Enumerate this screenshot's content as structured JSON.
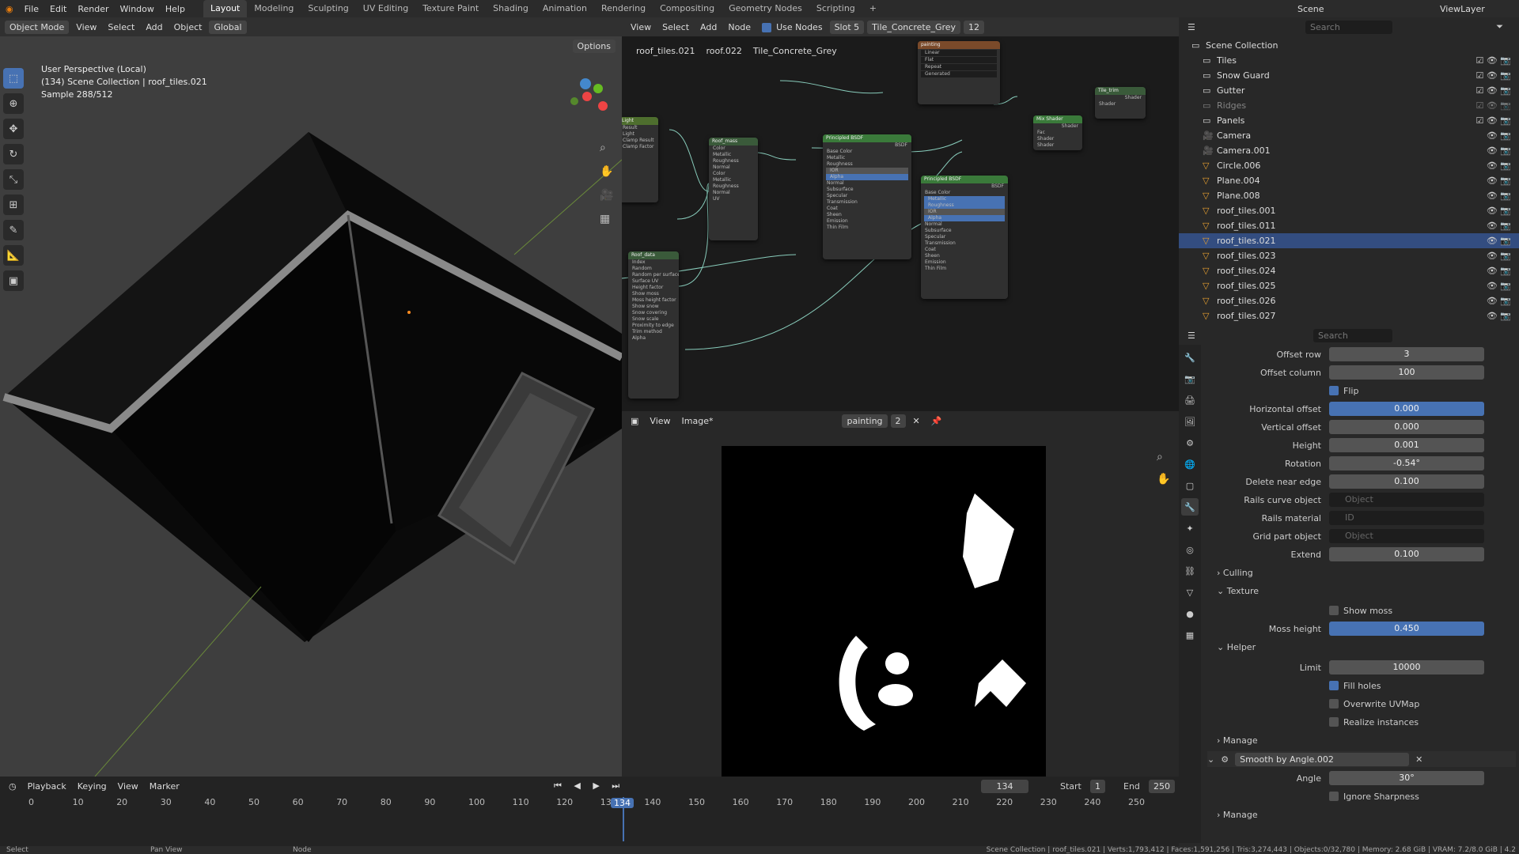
{
  "menu": [
    "File",
    "Edit",
    "Render",
    "Window",
    "Help"
  ],
  "workspaces": [
    "Layout",
    "Modeling",
    "Sculpting",
    "UV Editing",
    "Texture Paint",
    "Shading",
    "Animation",
    "Rendering",
    "Compositing",
    "Geometry Nodes",
    "Scripting"
  ],
  "top_right": {
    "scene": "Scene",
    "view_layer": "ViewLayer"
  },
  "viewport": {
    "mode": "Object Mode",
    "menus": [
      "View",
      "Select",
      "Add",
      "Object"
    ],
    "orientation": "Global",
    "options": "Options",
    "info_line1": "User Perspective (Local)",
    "info_line2": "(134) Scene Collection | roof_tiles.021",
    "info_line3": "Sample 288/512"
  },
  "node_editor": {
    "menus": [
      "View",
      "Select",
      "Add",
      "Node"
    ],
    "use_nodes": "Use Nodes",
    "slot": "Slot 5",
    "material": "Tile_Concrete_Grey",
    "users": "12",
    "breadcrumb": [
      "roof_tiles.021",
      "roof.022",
      "Tile_Concrete_Grey"
    ],
    "nodes": {
      "roof_mass": {
        "title": "Roof_mass",
        "rows": [
          "Color",
          "Metallic",
          "Roughness",
          "Normal",
          "Color",
          "Metallic",
          "Roughness",
          "Normal",
          "UV"
        ]
      },
      "roof_data": {
        "title": "Roof_data",
        "rows": [
          "Index",
          "Random",
          "Random per surface",
          "Surface UV",
          "Height factor",
          "Show moss",
          "Moss height factor",
          "Show snow",
          "Snow covering",
          "Snow scale",
          "Proximity to edge",
          "Trim method",
          "Alpha"
        ]
      },
      "bsdf1": {
        "title": "Principled BSDF",
        "rows": [
          "BSDF",
          "Base Color",
          "Metallic",
          "Roughness",
          "IOR",
          "Alpha",
          "Normal",
          "Subsurface",
          "Specular",
          "Transmission",
          "Coat",
          "Sheen",
          "Emission",
          "Thin Film"
        ]
      },
      "bsdf2": {
        "title": "Principled BSDF",
        "rows": [
          "BSDF",
          "Base Color",
          "Metallic",
          "Roughness",
          "IOR",
          "Alpha",
          "Normal",
          "Subsurface",
          "Specular",
          "Transmission",
          "Coat",
          "Sheen",
          "Emission",
          "Thin Film"
        ]
      },
      "mix": {
        "title": "Mix Shader",
        "rows": [
          "Shader",
          "Fac",
          "Shader",
          "Shader"
        ]
      },
      "tile_trim": {
        "title": "Tile_trim",
        "rows": [
          "Shader",
          "Shader"
        ]
      },
      "img": {
        "title": "painting",
        "rows": [
          "Linear",
          "Flat",
          "Repeat",
          "Generated"
        ]
      },
      "light": {
        "title": "Light",
        "rows": [
          "Result",
          "Light",
          "Clamp Result",
          "Clamp Factor"
        ]
      }
    }
  },
  "image_editor": {
    "menus": [
      "View",
      "Image*"
    ],
    "image": "painting",
    "users": "2"
  },
  "outliner": {
    "search": "Search",
    "root": "Scene Collection",
    "items": [
      "Tiles",
      "Snow Guard",
      "Gutter",
      "Ridges",
      "Panels",
      "Camera",
      "Camera.001",
      "Circle.006",
      "Plane.004",
      "Plane.008",
      "roof_tiles.001",
      "roof_tiles.011",
      "roof_tiles.021",
      "roof_tiles.023",
      "roof_tiles.024",
      "roof_tiles.025",
      "roof_tiles.026",
      "roof_tiles.027"
    ]
  },
  "properties": {
    "search": "Search",
    "rows": [
      {
        "label": "Offset row",
        "value": "3"
      },
      {
        "label": "Offset column",
        "value": "100"
      },
      {
        "label": "Horizontal offset",
        "value": "0.000"
      },
      {
        "label": "Vertical offset",
        "value": "0.000"
      },
      {
        "label": "Height",
        "value": "0.001"
      },
      {
        "label": "Rotation",
        "value": "-0.54°"
      },
      {
        "label": "Delete near edge",
        "value": "0.100"
      },
      {
        "label": "Rails curve object",
        "value": "Object"
      },
      {
        "label": "Rails material",
        "value": "ID"
      },
      {
        "label": "Grid part object",
        "value": "Object"
      },
      {
        "label": "Extend",
        "value": "0.100"
      },
      {
        "label": "Moss height",
        "value": "0.450"
      },
      {
        "label": "Limit",
        "value": "10000"
      },
      {
        "label": "Angle",
        "value": "30°"
      }
    ],
    "flip": "Flip",
    "culling": "Culling",
    "texture": "Texture",
    "show_moss": "Show moss",
    "helper": "Helper",
    "fill_holes": "Fill holes",
    "overwrite_uvmap": "Overwrite UVMap",
    "realize_instances": "Realize instances",
    "manage": "Manage",
    "modifier": "Smooth by Angle.002",
    "ignore_sharpness": "Ignore Sharpness"
  },
  "timeline": {
    "menus": [
      "Playback",
      "Keying",
      "View",
      "Marker"
    ],
    "current_frame": "134",
    "start_label": "Start",
    "start": "1",
    "end_label": "End",
    "end": "250",
    "ticks": [
      "0",
      "10",
      "20",
      "30",
      "40",
      "50",
      "60",
      "70",
      "80",
      "90",
      "100",
      "110",
      "120",
      "130",
      "140",
      "150",
      "160",
      "170",
      "180",
      "190",
      "200",
      "210",
      "220",
      "230",
      "240",
      "250"
    ]
  },
  "status": {
    "left": "Select",
    "mid": "Pan View",
    "node": "Node",
    "right": "Scene Collection | roof_tiles.021 | Verts:1,793,412 | Faces:1,591,256 | Tris:3,274,443 | Objects:0/32,780 | Memory: 2.68 GiB | VRAM: 7.2/8.0 GiB | 4.2"
  }
}
